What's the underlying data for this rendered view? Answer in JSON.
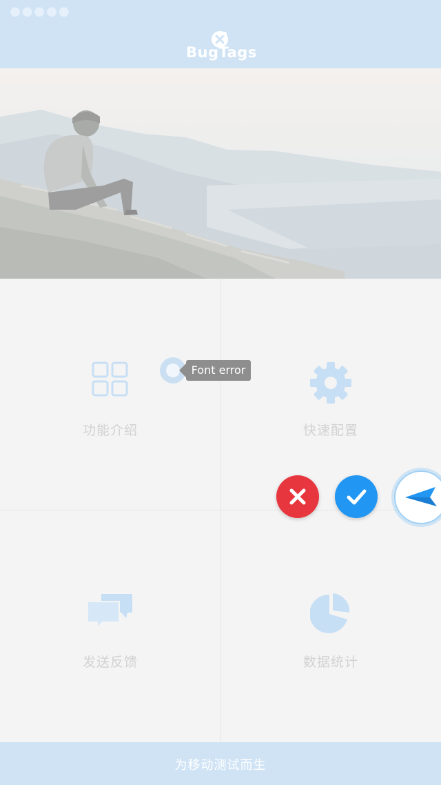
{
  "status_bar": {
    "left_text": "●●●●● ",
    "center_text": "",
    "right_text": ""
  },
  "header": {
    "logo_text": "BugTags"
  },
  "grid": {
    "items": [
      {
        "label": "功能介绍",
        "icon": "grid-icon"
      },
      {
        "label": "快速配置",
        "icon": "gear-icon"
      },
      {
        "label": "发送反馈",
        "icon": "chat-icon"
      },
      {
        "label": "数据统计",
        "icon": "pie-chart-icon"
      }
    ]
  },
  "tooltip": {
    "text": "Font error"
  },
  "footer": {
    "text": "为移动测试而生"
  },
  "colors": {
    "header_bg": "#cfe3f5",
    "icon_color": "#c7dff4",
    "cancel": "#e8363f",
    "confirm": "#2196f3",
    "send": "#2196f3"
  }
}
